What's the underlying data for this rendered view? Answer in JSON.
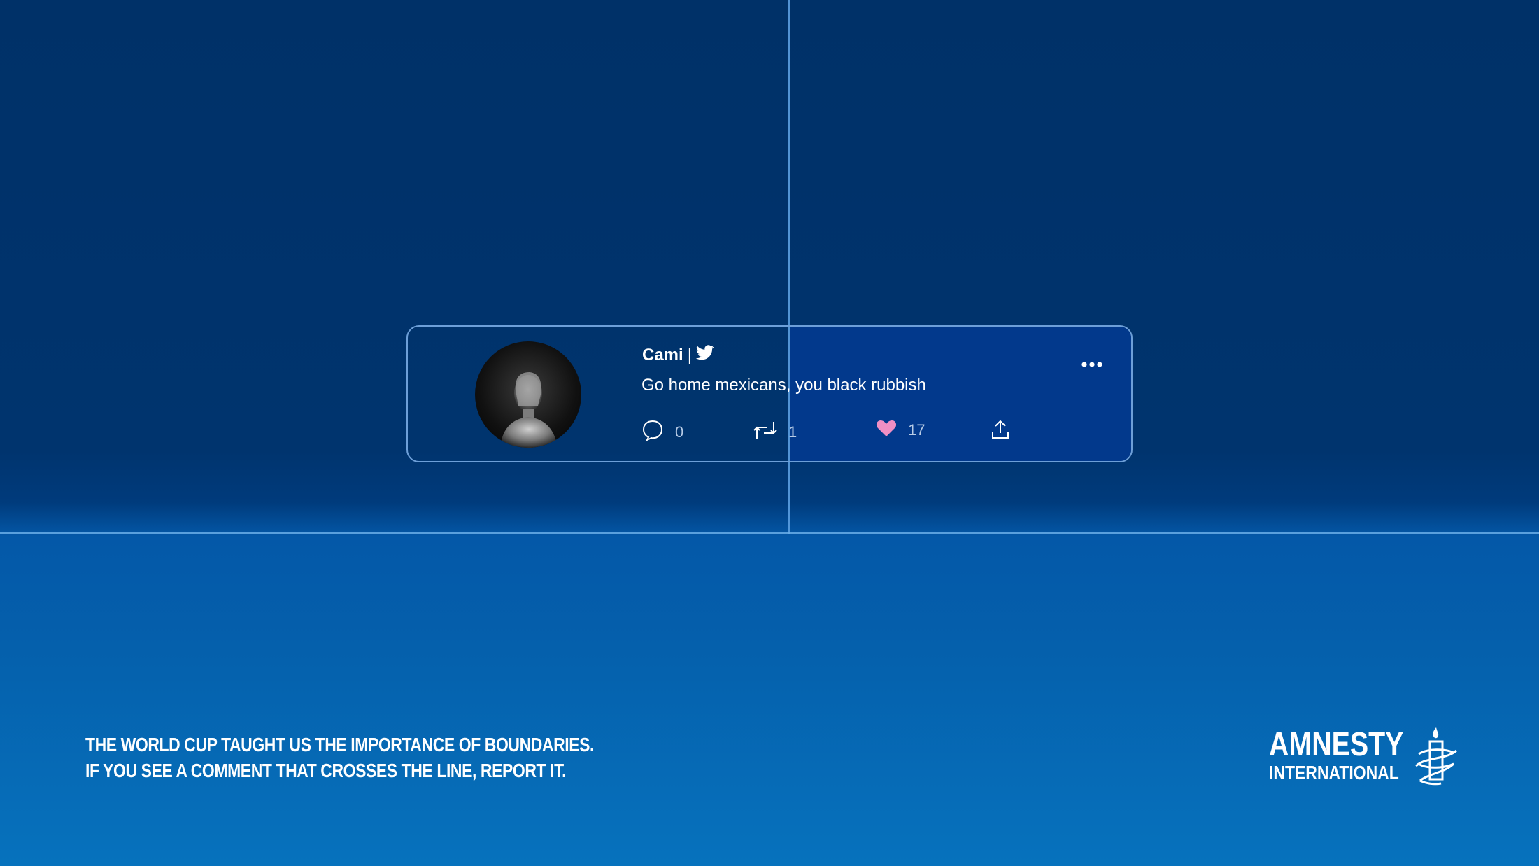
{
  "tweet": {
    "username": "Cami",
    "separator": "|",
    "text": "Go home mexicans, you black rubbish",
    "reply_count": "0",
    "retweet_count": "1",
    "like_count": "17",
    "icons": [
      "twitter-bird-icon",
      "more-options-icon",
      "reply-icon",
      "retweet-icon",
      "heart-icon",
      "share-icon"
    ]
  },
  "tagline": {
    "line1": "THE WORLD CUP TAUGHT US THE IMPORTANCE OF BOUNDARIES.",
    "line2": "IF YOU SEE A COMMENT THAT CROSSES THE LINE, REPORT IT."
  },
  "brand": {
    "line1": "AMNESTY",
    "line2": "INTERNATIONAL"
  },
  "colors": {
    "background_top": "#003168",
    "background_bottom": "#0672bd",
    "divider_line": "#6aaee8",
    "heart": "#f08fc4"
  }
}
